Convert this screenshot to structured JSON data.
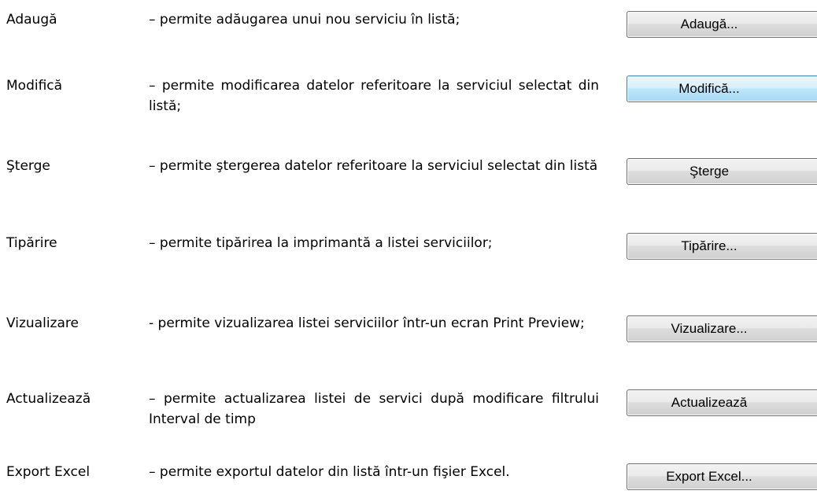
{
  "items": [
    {
      "term": "Adaugă",
      "description": "– permite adăugarea unui nou serviciu în listă;",
      "button": "Adaugă..."
    },
    {
      "term": "Modifică",
      "description": "– permite modificarea datelor referitoare la serviciul selectat din listă;",
      "button": "Modifică..."
    },
    {
      "term": "Şterge",
      "description": "– permite ştergerea datelor referitoare la serviciul selectat din listă",
      "button": "Şterge"
    },
    {
      "term": "Tipărire",
      "description": "– permite tipărirea la imprimantă a listei serviciilor;",
      "button": "Tipărire..."
    },
    {
      "term": "Vizualizare",
      "description": "- permite vizualizarea listei serviciilor într-un ecran Print Preview;",
      "button": "Vizualizare..."
    },
    {
      "term": "Actualizează",
      "description": "– permite actualizarea listei de servici după modificare filtrului Interval de timp",
      "button": "Actualizează"
    },
    {
      "term": "Export Excel",
      "description": "– permite exportul datelor din listă într-un fişier Excel.",
      "button": "Export Excel..."
    }
  ],
  "colors": {
    "button_default_bg": "#e5e5e5",
    "button_hover_bg": "#bee6fd",
    "button_hover_border": "#3c7fb1"
  }
}
